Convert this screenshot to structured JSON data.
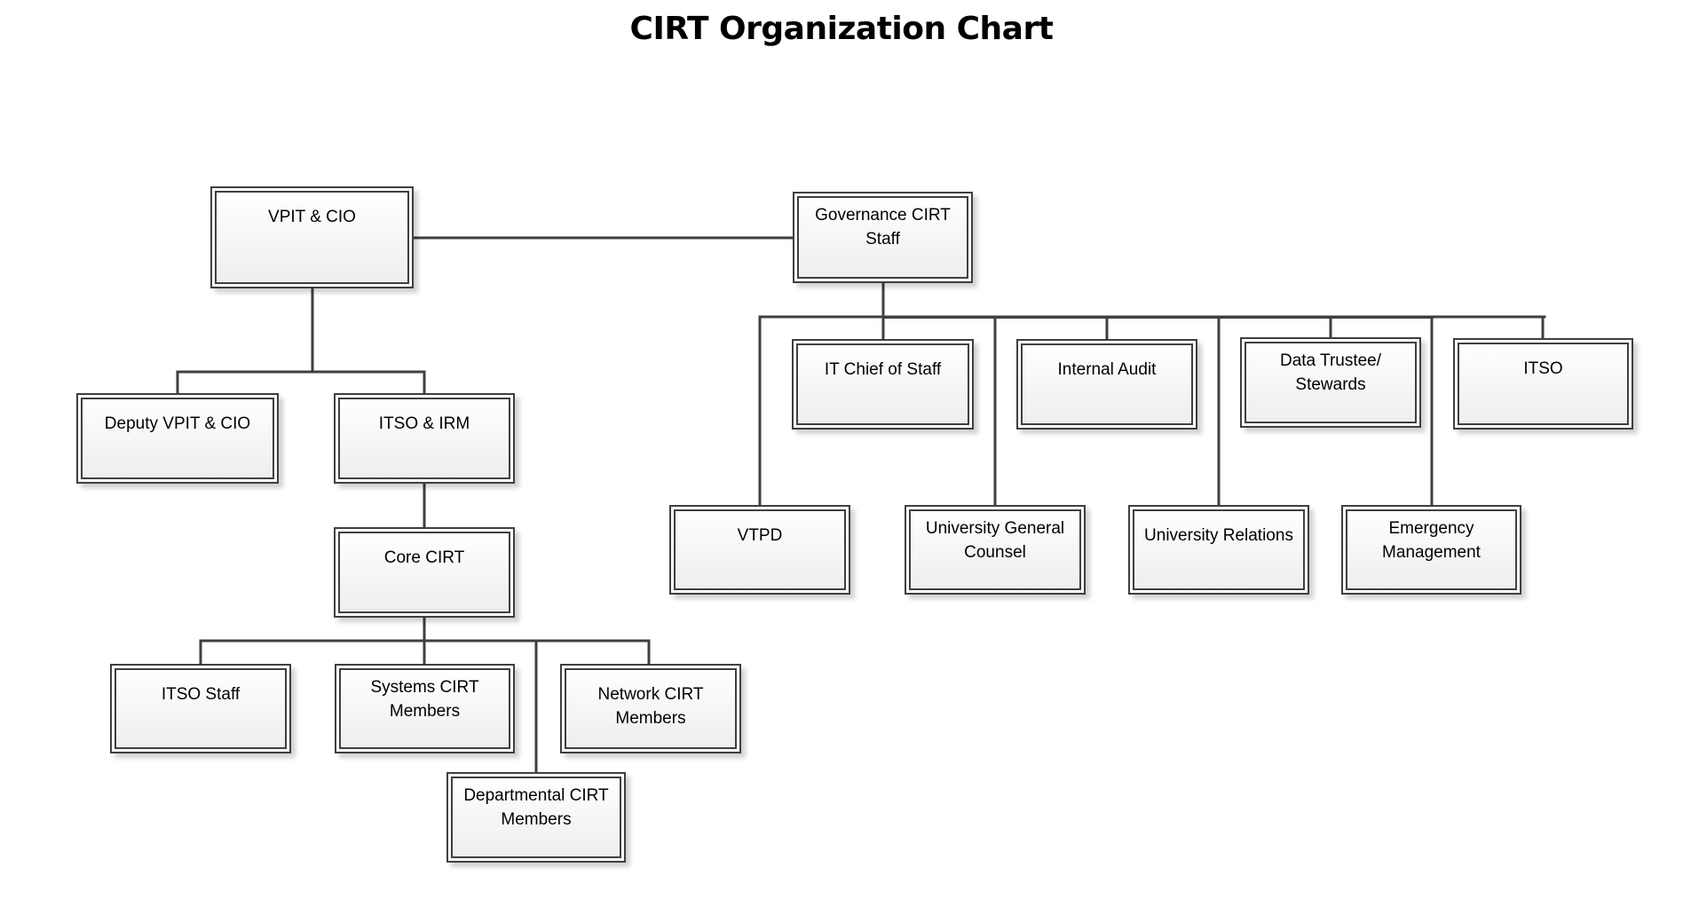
{
  "title": "CIRT Organization Chart",
  "colors": {
    "line": "#3f3f3f",
    "box_border": "#3f3f3f",
    "box_fill_top": "#ffffff",
    "box_fill_bottom": "#eeeeee",
    "title_text": "#000000"
  },
  "nodes": {
    "vpit_cio": {
      "label": "VPIT & CIO"
    },
    "governance": {
      "label": "Governance CIRT\nStaff"
    },
    "deputy": {
      "label": "Deputy VPIT & CIO"
    },
    "itso_irm": {
      "label": "ITSO & IRM"
    },
    "core_cirt": {
      "label": "Core CIRT"
    },
    "itso_staff": {
      "label": "ITSO Staff"
    },
    "systems_cirt": {
      "label": "Systems CIRT\nMembers"
    },
    "network_cirt": {
      "label": "Network CIRT\nMembers"
    },
    "departmental_cirt": {
      "label": "Departmental CIRT\nMembers"
    },
    "it_chief": {
      "label": "IT Chief of Staff"
    },
    "internal_audit": {
      "label": "Internal Audit"
    },
    "data_trustee": {
      "label": "Data Trustee/\nStewards"
    },
    "itso": {
      "label": "ITSO"
    },
    "vtpd": {
      "label": "VTPD"
    },
    "general_counsel": {
      "label": "University General\nCounsel"
    },
    "univ_relations": {
      "label": "University Relations"
    },
    "emergency": {
      "label": "Emergency\nManagement"
    }
  },
  "relationships": [
    {
      "from": "VPIT & CIO",
      "to": "Governance CIRT Staff",
      "type": "peer"
    },
    {
      "from": "VPIT & CIO",
      "to": "Deputy VPIT & CIO"
    },
    {
      "from": "VPIT & CIO",
      "to": "ITSO & IRM"
    },
    {
      "from": "ITSO & IRM",
      "to": "Core CIRT"
    },
    {
      "from": "Core CIRT",
      "to": "ITSO Staff"
    },
    {
      "from": "Core CIRT",
      "to": "Systems CIRT Members"
    },
    {
      "from": "Core CIRT",
      "to": "Departmental CIRT Members"
    },
    {
      "from": "Core CIRT",
      "to": "Network CIRT Members"
    },
    {
      "from": "Governance CIRT Staff",
      "to": "VTPD"
    },
    {
      "from": "Governance CIRT Staff",
      "to": "IT Chief of Staff"
    },
    {
      "from": "Governance CIRT Staff",
      "to": "University General Counsel"
    },
    {
      "from": "Governance CIRT Staff",
      "to": "Internal Audit"
    },
    {
      "from": "Governance CIRT Staff",
      "to": "University Relations"
    },
    {
      "from": "Governance CIRT Staff",
      "to": "Data Trustee/ Stewards"
    },
    {
      "from": "Governance CIRT Staff",
      "to": "Emergency Management"
    },
    {
      "from": "Governance CIRT Staff",
      "to": "ITSO"
    }
  ]
}
